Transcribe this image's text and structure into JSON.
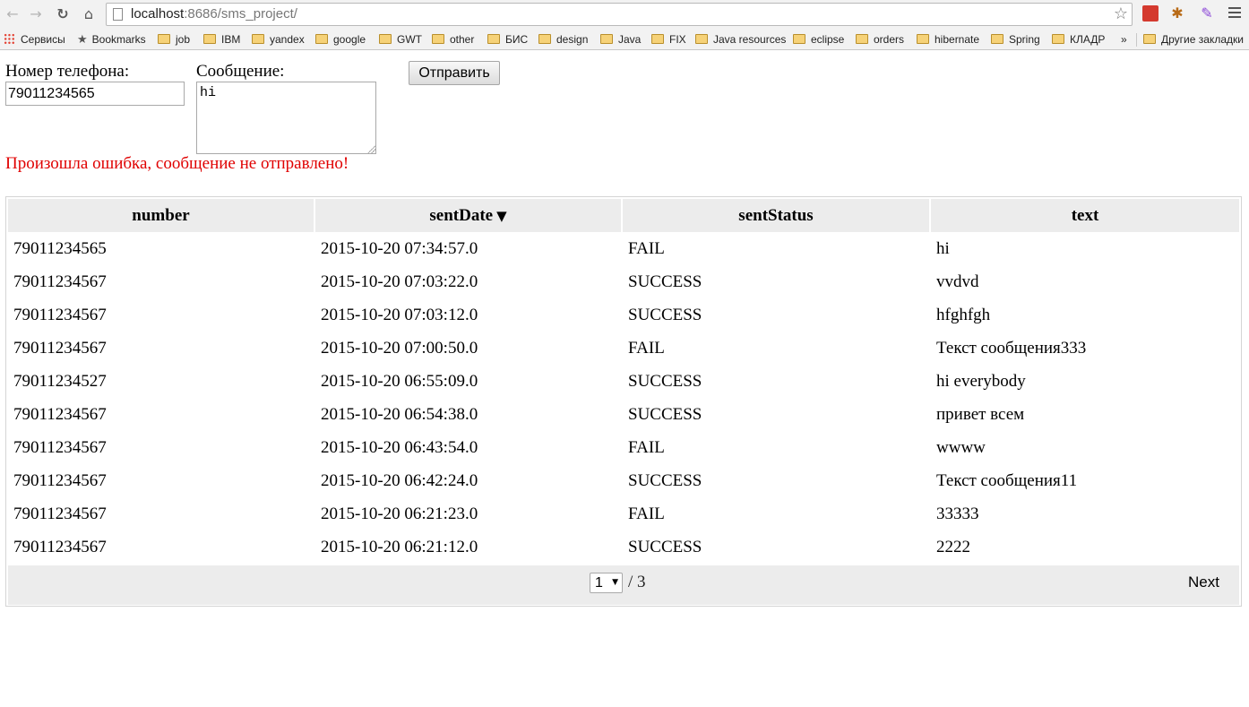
{
  "browser": {
    "url_host": "localhost",
    "url_path": ":8686/sms_project/",
    "bookmarks": [
      "Сервисы",
      "Bookmarks",
      "job",
      "IBM",
      "yandex",
      "google",
      "GWT",
      "other",
      "БИС",
      "design",
      "Java",
      "FIX",
      "Java resources",
      "eclipse",
      "orders",
      "hibernate",
      "Spring",
      "КЛАДР",
      "»",
      "Другие закладки"
    ]
  },
  "form": {
    "phone_label": "Номер телефона:",
    "phone_value": "79011234565",
    "message_label": "Сообщение:",
    "message_value": "hi",
    "send_button": "Отправить",
    "error_message": "Произошла ошибка, сообщение не отправлено!"
  },
  "table": {
    "columns": [
      "number",
      "sentDate",
      "sentStatus",
      "text"
    ],
    "sort_indicator": "▼",
    "rows": [
      [
        "79011234565",
        "2015-10-20 07:34:57.0",
        "FAIL",
        "hi"
      ],
      [
        "79011234567",
        "2015-10-20 07:03:22.0",
        "SUCCESS",
        "vvdvd"
      ],
      [
        "79011234567",
        "2015-10-20 07:03:12.0",
        "SUCCESS",
        "hfghfgh"
      ],
      [
        "79011234567",
        "2015-10-20 07:00:50.0",
        "FAIL",
        "Текст сообщения333"
      ],
      [
        "79011234527",
        "2015-10-20 06:55:09.0",
        "SUCCESS",
        "hi everybody"
      ],
      [
        "79011234567",
        "2015-10-20 06:54:38.0",
        "SUCCESS",
        "привет всем"
      ],
      [
        "79011234567",
        "2015-10-20 06:43:54.0",
        "FAIL",
        "wwww"
      ],
      [
        "79011234567",
        "2015-10-20 06:42:24.0",
        "SUCCESS",
        "Текст сообщения11"
      ],
      [
        "79011234567",
        "2015-10-20 06:21:23.0",
        "FAIL",
        "33333"
      ],
      [
        "79011234567",
        "2015-10-20 06:21:12.0",
        "SUCCESS",
        "2222"
      ]
    ]
  },
  "pager": {
    "current_page": "1",
    "total": "/ 3",
    "next_label": "Next"
  },
  "colors": {
    "error": "#e00000",
    "header_bg": "#ececec"
  }
}
